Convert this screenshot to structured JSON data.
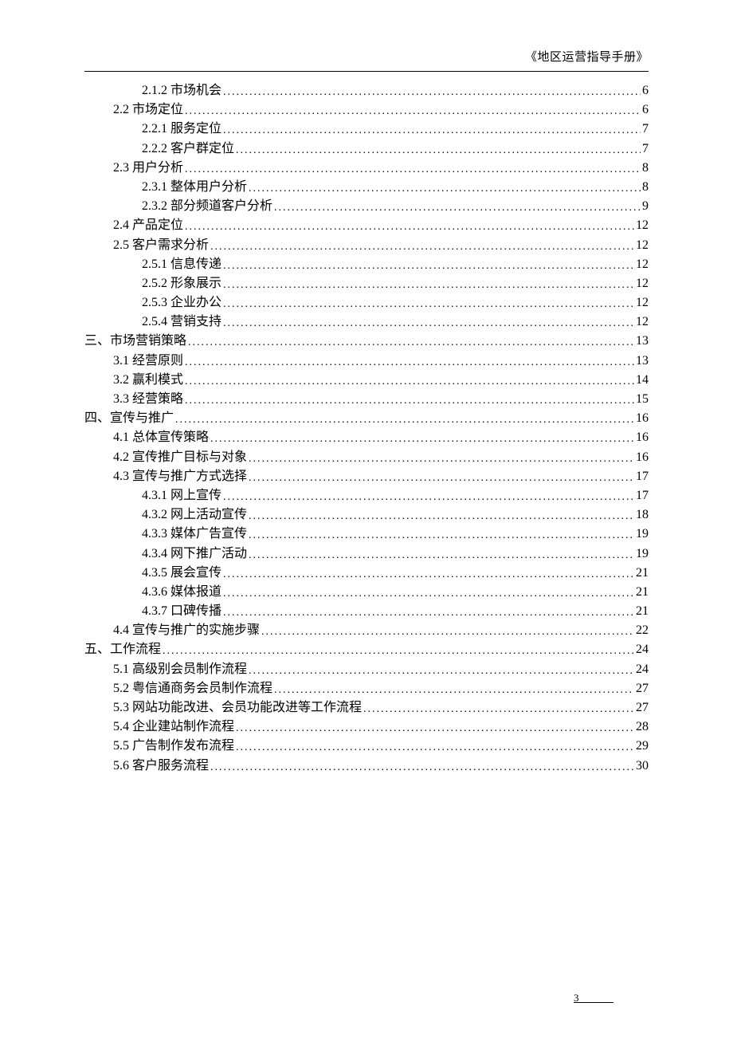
{
  "header_title": "《地区运营指导手册》",
  "page_number": "3",
  "toc": [
    {
      "level": 3,
      "label": "2.1.2 市场机会",
      "page": "6"
    },
    {
      "level": 2,
      "label": "2.2 市场定位",
      "page": "6"
    },
    {
      "level": 3,
      "label": "2.2.1 服务定位",
      "page": "7"
    },
    {
      "level": 3,
      "label": "2.2.2 客户群定位",
      "page": "7"
    },
    {
      "level": 2,
      "label": "2.3 用户分析",
      "page": "8"
    },
    {
      "level": 3,
      "label": "2.3.1 整体用户分析",
      "page": "8"
    },
    {
      "level": 3,
      "label": "2.3.2 部分频道客户分析",
      "page": "9"
    },
    {
      "level": 2,
      "label": "2.4 产品定位",
      "page": "12"
    },
    {
      "level": 2,
      "label": "2.5 客户需求分析",
      "page": "12"
    },
    {
      "level": 3,
      "label": "2.5.1 信息传递",
      "page": "12"
    },
    {
      "level": 3,
      "label": "2.5.2 形象展示",
      "page": "12"
    },
    {
      "level": 3,
      "label": "2.5.3 企业办公",
      "page": "12"
    },
    {
      "level": 3,
      "label": "2.5.4 营销支持",
      "page": "12"
    },
    {
      "level": 1,
      "label": "三、市场营销策略",
      "page": "13"
    },
    {
      "level": 2,
      "label": "3.1 经营原则",
      "page": "13"
    },
    {
      "level": 2,
      "label": "3.2 赢利模式",
      "page": "14"
    },
    {
      "level": 2,
      "label": "3.3 经营策略",
      "page": "15"
    },
    {
      "level": 1,
      "label": "四、宣传与推广",
      "page": "16"
    },
    {
      "level": 2,
      "label": "4.1 总体宣传策略",
      "page": "16"
    },
    {
      "level": 2,
      "label": "4.2 宣传推广目标与对象",
      "page": "16"
    },
    {
      "level": 2,
      "label": "4.3 宣传与推广方式选择",
      "page": "17"
    },
    {
      "level": 3,
      "label": "4.3.1 网上宣传",
      "page": "17"
    },
    {
      "level": 3,
      "label": "4.3.2 网上活动宣传",
      "page": "18"
    },
    {
      "level": 3,
      "label": "4.3.3 媒体广告宣传",
      "page": "19"
    },
    {
      "level": 3,
      "label": "4.3.4 网下推广活动",
      "page": "19"
    },
    {
      "level": 3,
      "label": "4.3.5 展会宣传",
      "page": "21"
    },
    {
      "level": 3,
      "label": "4.3.6 媒体报道",
      "page": "21"
    },
    {
      "level": 3,
      "label": "4.3.7 口碑传播",
      "page": "21"
    },
    {
      "level": 2,
      "label": "4.4 宣传与推广的实施步骤",
      "page": "22"
    },
    {
      "level": 1,
      "label": "五、工作流程",
      "page": "24"
    },
    {
      "level": 2,
      "label": "5.1 高级别会员制作流程",
      "page": "24"
    },
    {
      "level": 2,
      "label": "5.2 粤信通商务会员制作流程",
      "page": "27"
    },
    {
      "level": 2,
      "label": "5.3 网站功能改进、会员功能改进等工作流程",
      "page": "27"
    },
    {
      "level": 2,
      "label": "5.4 企业建站制作流程",
      "page": "28"
    },
    {
      "level": 2,
      "label": "5.5 广告制作发布流程",
      "page": "29"
    },
    {
      "level": 2,
      "label": "5.6 客户服务流程",
      "page": "30"
    }
  ]
}
